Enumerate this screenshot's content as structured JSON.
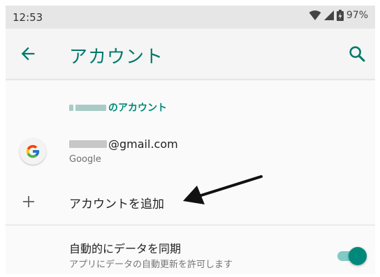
{
  "status_bar": {
    "time": "12:53",
    "battery": "97%",
    "icons": [
      "wifi-icon",
      "cellular-signal-icon",
      "battery-charging-icon"
    ]
  },
  "app_bar": {
    "title": "アカウント",
    "back_icon": "back-arrow-icon",
    "search_icon": "search-icon"
  },
  "section": {
    "header_suffix": "のアカウント"
  },
  "account": {
    "email_suffix": "@gmail.com",
    "provider": "Google",
    "icon": "google-logo-icon"
  },
  "add_account": {
    "label": "アカウントを追加",
    "icon": "plus-icon"
  },
  "sync": {
    "title": "自動的にデータを同期",
    "subtitle": "アプリにデータの自動更新を許可します",
    "enabled": true
  },
  "colors": {
    "accent": "#00796b",
    "accent_light": "#80cbc4",
    "status_bar": "#e6e6e6",
    "app_bar": "#f5f5f5"
  },
  "annotation": {
    "icon": "pointer-arrow-icon"
  }
}
